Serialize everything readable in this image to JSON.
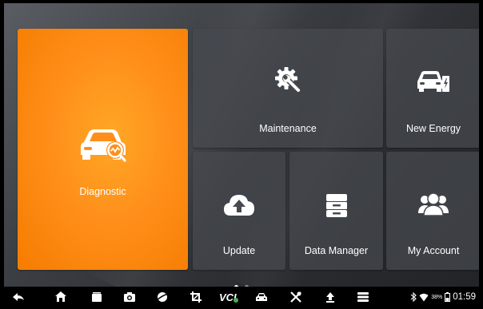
{
  "tiles": {
    "diagnostic": {
      "label": "Diagnostic",
      "icon": "car-diagnostic-icon"
    },
    "maintenance": {
      "label": "Maintenance",
      "icon": "gear-wrench-icon"
    },
    "new_energy": {
      "label": "New Energy",
      "icon": "ev-car-charger-icon"
    },
    "update": {
      "label": "Update",
      "icon": "cloud-upload-icon"
    },
    "data_manager": {
      "label": "Data Manager",
      "icon": "file-drawer-icon"
    },
    "my_account": {
      "label": "My Account",
      "icon": "users-icon"
    }
  },
  "pager": {
    "pages": 2,
    "current": 1
  },
  "navbar": {
    "icons": [
      "back-icon",
      "home-icon",
      "recents-icon",
      "camera-icon",
      "browser-icon",
      "crop-icon",
      "vci-icon",
      "car-icon",
      "tools-icon",
      "upload-icon",
      "menu-icon"
    ],
    "vci_text": "VCI"
  },
  "status": {
    "battery_percent": "38%",
    "time": "01:59"
  },
  "colors": {
    "diagnostic_tile": "#ff8f1a",
    "tile_bg": "#46494f",
    "vci_connected": "#4caf50"
  }
}
